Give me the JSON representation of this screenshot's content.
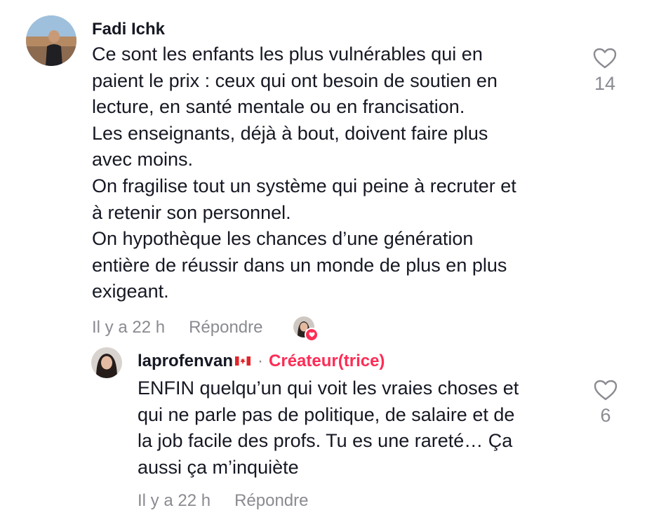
{
  "comment": {
    "username": "Fadi Ichk",
    "text_lines": [
      "Ce sont les enfants les plus vulnérables qui en",
      "paient le prix : ceux qui ont besoin de soutien en",
      "lecture, en santé mentale ou en francisation.",
      "Les enseignants, déjà à bout, doivent faire plus",
      "avec moins.",
      "On fragilise tout un système qui peine à recruter et",
      "à retenir son personnel.",
      "On hypothèque les chances d’une génération",
      "entière de réussir dans un monde de plus en plus",
      "exigeant."
    ],
    "timestamp": "Il y a 22 h",
    "reply_label": "Répondre",
    "like_count": "14",
    "liked_by_creator_icon": "creator-heart-badge"
  },
  "reply": {
    "username": "laprofenvan",
    "flag_icon": "canada-flag",
    "separator": "·",
    "creator_label": "Créateur(trice)",
    "text_lines": [
      "ENFIN quelqu’un qui voit les vraies choses et",
      "qui ne parle pas de politique, de salaire et de",
      "la job facile des profs. Tu es une rareté… Ça",
      "aussi ça m’inquiète"
    ],
    "timestamp": "Il y a 22 h",
    "reply_label": "Répondre",
    "like_count": "6"
  },
  "colors": {
    "text": "#161823",
    "muted": "#8a8b91",
    "accent": "#fe2c55"
  }
}
